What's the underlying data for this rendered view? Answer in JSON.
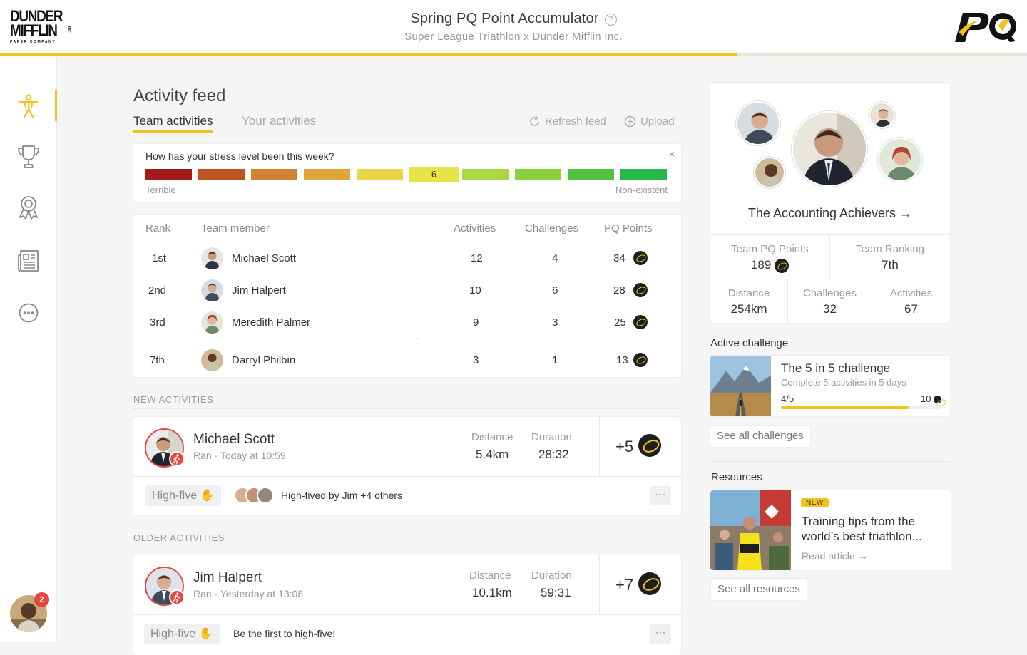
{
  "header": {
    "company_logo": {
      "line1": "DUNDER",
      "line2": "MIFFLIN",
      "inc": "INC",
      "tagline": "PAPER COMPANY"
    },
    "title": "Spring PQ Point Accumulator",
    "help_icon": "question-circle-icon",
    "subtitle": "Super League Triathlon x Dunder Mifflin Inc.",
    "progress": 0.718,
    "brand_logo": "PQ"
  },
  "sidebar": {
    "items": [
      {
        "name": "activity",
        "icon": "person-icon",
        "active": true
      },
      {
        "name": "trophy",
        "icon": "trophy-icon",
        "active": false
      },
      {
        "name": "awards",
        "icon": "award-ribbon-icon",
        "active": false
      },
      {
        "name": "news",
        "icon": "newspaper-icon",
        "active": false
      },
      {
        "name": "more",
        "icon": "more-circle-icon",
        "active": false
      }
    ],
    "notification_count": "2"
  },
  "feed": {
    "title": "Activity feed",
    "tabs": [
      "Team activities",
      "Your activities"
    ],
    "actions": {
      "refresh": "Refresh feed",
      "upload": "Upload"
    }
  },
  "stress": {
    "question": "How has your stress level been this week?",
    "close": "×",
    "selected_label": "6",
    "low_label": "Terrible",
    "high_label": "Non-existent",
    "colors": [
      "#a31a1a",
      "#bd5425",
      "#d08232",
      "#dfa63a",
      "#e9d44a",
      "#e9e446",
      "#a9d843",
      "#8ccf3f",
      "#54c240",
      "#25b94b"
    ],
    "selected_index": 5
  },
  "leaderboard": {
    "headers": [
      "Rank",
      "Team member",
      "Activities",
      "Challenges",
      "PQ Points"
    ],
    "rows": [
      {
        "rank": "1st",
        "name": "Michael Scott",
        "activities": "12",
        "challenges": "4",
        "points": "34"
      },
      {
        "rank": "2nd",
        "name": "Jim Halpert",
        "activities": "10",
        "challenges": "6",
        "points": "28"
      },
      {
        "rank": "3rd",
        "name": "Meredith Palmer",
        "activities": "9",
        "challenges": "3",
        "points": "25"
      },
      {
        "rank": "7th",
        "name": "Darryl Philbin",
        "activities": "3",
        "challenges": "1",
        "points": "13"
      }
    ],
    "gap": "..."
  },
  "new_activities": {
    "label": "NEW ACTIVITIES",
    "item": {
      "name": "Michael Scott",
      "sub": "Ran · Today at 10:59",
      "distance_label": "Distance",
      "distance": "5.4km",
      "duration_label": "Duration",
      "duration": "28:32",
      "points": "+5",
      "high_five": "High-five",
      "high_five_text": "High-fived by Jim +4 others",
      "more": "···"
    }
  },
  "older_activities": {
    "label": "OLDER ACTIVITIES",
    "item": {
      "name": "Jim Halpert",
      "sub": "Ran · Yesterday at 13:08",
      "distance_label": "Distance",
      "distance": "10.1km",
      "duration_label": "Duration",
      "duration": "59:31",
      "points": "+7",
      "high_five": "High-five",
      "high_five_text": "Be the first to high-five!",
      "more": "···"
    }
  },
  "team": {
    "name": "The Accounting Achievers",
    "arrow": "→",
    "pq_points_label": "Team PQ Points",
    "pq_points": "189",
    "ranking_label": "Team Ranking",
    "ranking": "7th",
    "distance_label": "Distance",
    "distance": "254km",
    "challenges_label": "Challenges",
    "challenges": "32",
    "activities_label": "Activities",
    "activities": "67"
  },
  "challenge": {
    "section": "Active challenge",
    "title": "The 5 in 5 challenge",
    "sub": "Complete 5 activities in 5 days",
    "progress_text": "4/5",
    "reward": "10",
    "progress": 0.8,
    "see_all": "See all challenges"
  },
  "resources": {
    "section": "Resources",
    "badge": "NEW",
    "title_line1": "Training tips from the",
    "title_line2": "world’s best triathlon...",
    "read": "Read article",
    "see_all": "See all resources"
  },
  "colors": {
    "accent": "#f3c21b",
    "alert": "#e8453c",
    "coin": "#1e1e1e"
  }
}
